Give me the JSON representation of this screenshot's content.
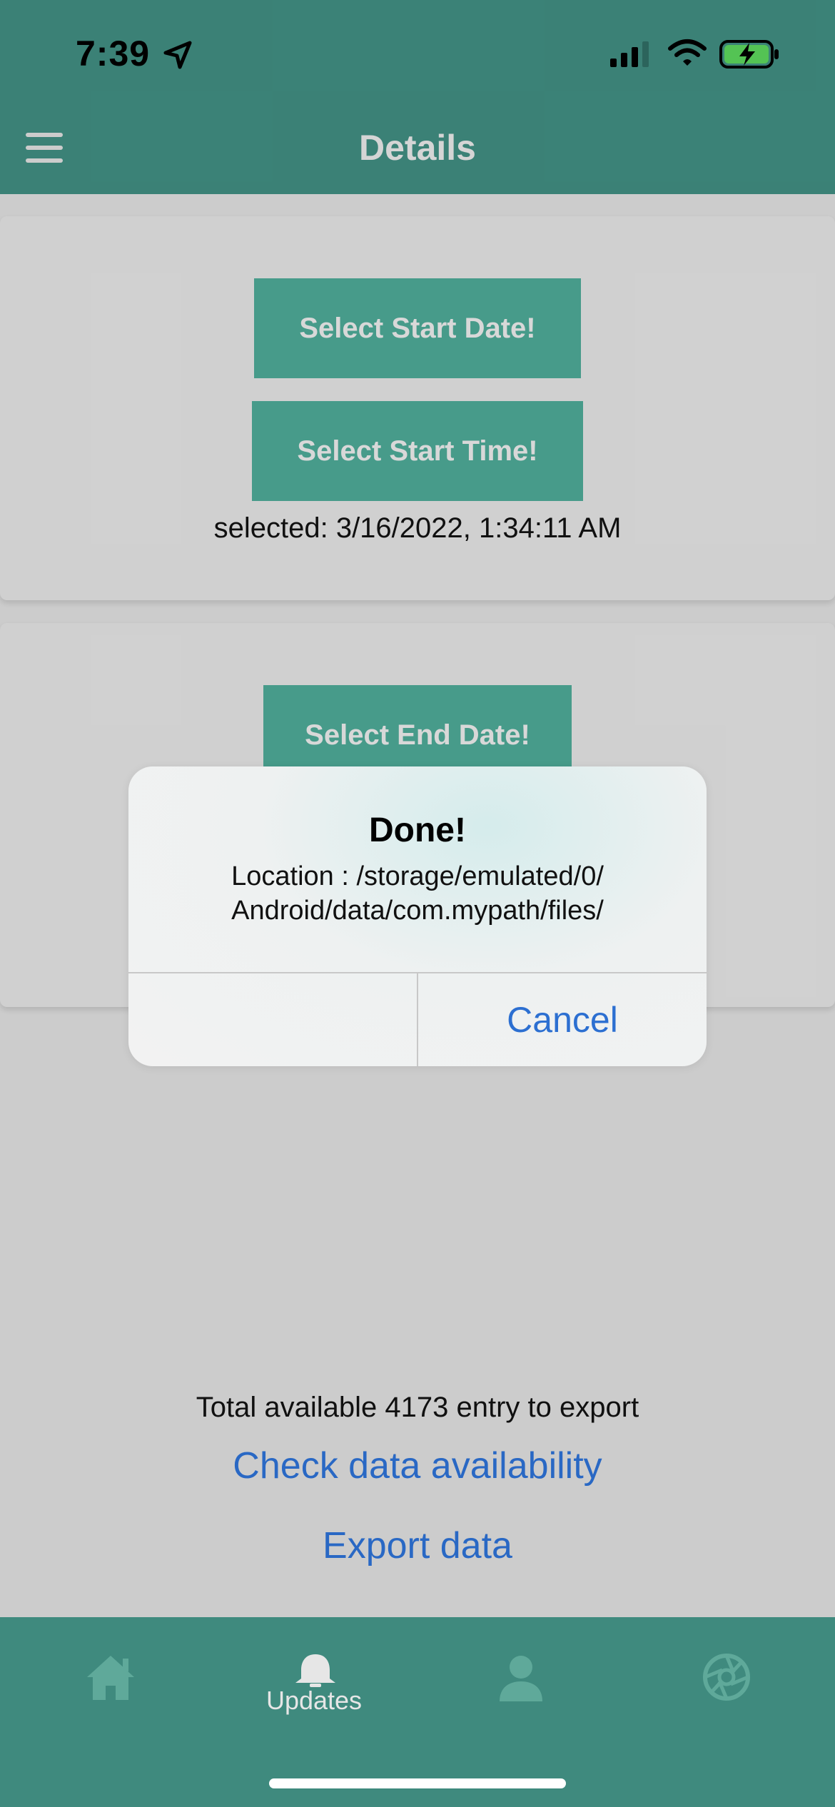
{
  "status_bar": {
    "time": "7:39"
  },
  "header": {
    "title": "Details"
  },
  "start_card": {
    "start_date_button": "Select Start Date!",
    "start_time_button": "Select Start Time!",
    "selected_text": "selected: 3/16/2022, 1:34:11 AM"
  },
  "end_card": {
    "end_date_button": "Select End Date!"
  },
  "alert": {
    "title": "Done!",
    "message": "Location : /storage/emulated/0/ Android/data/com.mypath/files/",
    "cancel_label": "Cancel"
  },
  "footer": {
    "total_text": "Total available 4173 entry to export",
    "check_link": "Check data availability",
    "export_link": "Export data"
  },
  "tabbar": {
    "items": [
      {
        "icon": "home-icon"
      },
      {
        "icon": "bell-icon",
        "label": "Updates"
      },
      {
        "icon": "person-icon"
      },
      {
        "icon": "aperture-icon"
      }
    ]
  },
  "colors": {
    "accent": "#3f8a7e",
    "button": "#4ca593",
    "link": "#2c6fd1",
    "battery": "#5ad05a"
  }
}
